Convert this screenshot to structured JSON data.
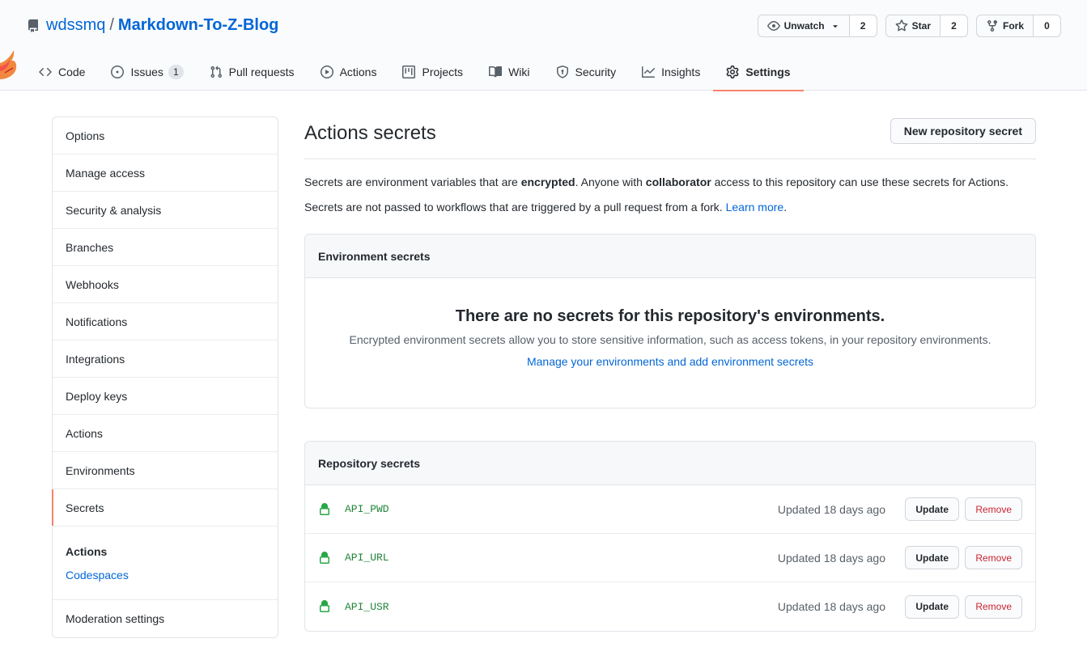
{
  "repo": {
    "owner": "wdssmq",
    "separator": "/",
    "name": "Markdown-To-Z-Blog"
  },
  "actions": [
    {
      "label": "Unwatch",
      "count": "2",
      "icon": "eye-icon"
    },
    {
      "label": "Star",
      "count": "2",
      "icon": "star-icon"
    },
    {
      "label": "Fork",
      "count": "0",
      "icon": "fork-icon"
    }
  ],
  "nav": [
    {
      "label": "Code",
      "icon": "code-icon"
    },
    {
      "label": "Issues",
      "icon": "issue-icon",
      "counter": "1"
    },
    {
      "label": "Pull requests",
      "icon": "pull-request-icon"
    },
    {
      "label": "Actions",
      "icon": "play-icon"
    },
    {
      "label": "Projects",
      "icon": "project-icon"
    },
    {
      "label": "Wiki",
      "icon": "book-icon"
    },
    {
      "label": "Security",
      "icon": "shield-icon"
    },
    {
      "label": "Insights",
      "icon": "graph-icon"
    },
    {
      "label": "Settings",
      "icon": "gear-icon",
      "selected": true
    }
  ],
  "sidebar": {
    "items": [
      "Options",
      "Manage access",
      "Security & analysis",
      "Branches",
      "Webhooks",
      "Notifications",
      "Integrations",
      "Deploy keys",
      "Actions",
      "Environments",
      "Secrets"
    ],
    "section_heading": "Actions",
    "section_link": "Codespaces",
    "last_item": "Moderation settings"
  },
  "main": {
    "title": "Actions secrets",
    "new_button": "New repository secret",
    "intro1_a": "Secrets are environment variables that are ",
    "intro1_b": "encrypted",
    "intro1_c": ". Anyone with ",
    "intro1_d": "collaborator",
    "intro1_e": " access to this repository can use these secrets for Actions.",
    "intro2_a": "Secrets are not passed to workflows that are triggered by a pull request from a fork. ",
    "intro2_link": "Learn more",
    "intro2_end": "."
  },
  "env": {
    "header": "Environment secrets",
    "blank_title": "There are no secrets for this repository's environments.",
    "blank_text": "Encrypted environment secrets allow you to store sensitive information, such as access tokens, in your repository environments.",
    "blank_link": "Manage your environments and add environment secrets"
  },
  "repo_secrets": {
    "header": "Repository secrets",
    "update_label": "Update",
    "remove_label": "Remove",
    "rows": [
      {
        "name": "API_PWD",
        "updated": "Updated 18 days ago"
      },
      {
        "name": "API_URL",
        "updated": "Updated 18 days ago"
      },
      {
        "name": "API_USR",
        "updated": "Updated 18 days ago"
      }
    ]
  },
  "colors": {
    "accent": "#f9826c",
    "link": "#0366d6",
    "secret_green": "#22863a",
    "danger": "#cb2431"
  }
}
